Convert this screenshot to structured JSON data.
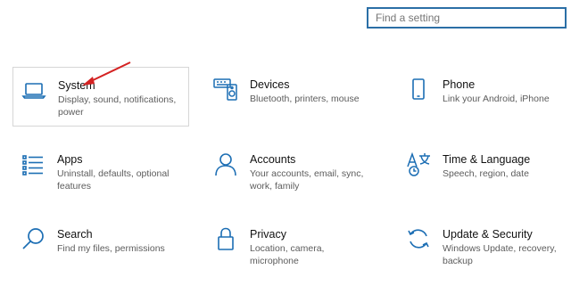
{
  "search": {
    "placeholder": "Find a setting"
  },
  "accent_color": "#1c6eb4",
  "annotation_color": "#d42222",
  "tiles": [
    {
      "icon": "laptop-icon",
      "title": "System",
      "desc": "Display, sound, notifications, power"
    },
    {
      "icon": "keyboard-speaker-icon",
      "title": "Devices",
      "desc": "Bluetooth, printers, mouse"
    },
    {
      "icon": "phone-icon",
      "title": "Phone",
      "desc": "Link your Android, iPhone"
    },
    {
      "icon": "apps-list-icon",
      "title": "Apps",
      "desc": "Uninstall, defaults, optional features"
    },
    {
      "icon": "person-icon",
      "title": "Accounts",
      "desc": "Your accounts, email, sync, work, family"
    },
    {
      "icon": "time-language-icon",
      "title": "Time & Language",
      "desc": "Speech, region, date"
    },
    {
      "icon": "search-icon",
      "title": "Search",
      "desc": "Find my files, permissions"
    },
    {
      "icon": "lock-icon",
      "title": "Privacy",
      "desc": "Location, camera, microphone"
    },
    {
      "icon": "sync-arrows-icon",
      "title": "Update & Security",
      "desc": "Windows Update, recovery, backup"
    }
  ]
}
